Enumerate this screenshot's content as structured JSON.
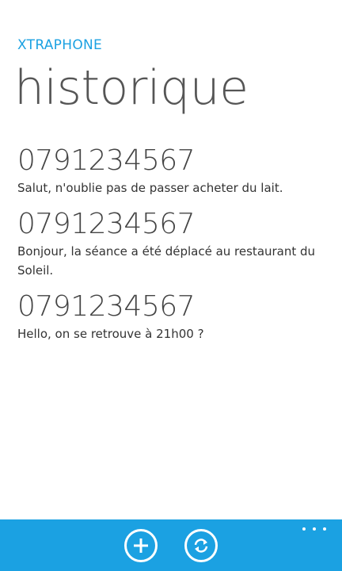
{
  "app": {
    "title": "XTRAPHONE",
    "page_title": "historique"
  },
  "messages": [
    {
      "number": "0791234567",
      "text": "Salut, n'oublie pas de passer acheter du lait."
    },
    {
      "number": "0791234567",
      "text": "Bonjour, la séance a été déplacé au restaurant du Soleil."
    },
    {
      "number": "0791234567",
      "text": "Hello, on se retrouve à 21h00 ?"
    }
  ],
  "app_bar": {
    "buttons": [
      {
        "icon": "add-icon"
      },
      {
        "icon": "sync-icon"
      }
    ],
    "more_icon": "ellipsis-icon",
    "background_color": "#1ba1e2"
  },
  "colors": {
    "accent": "#1ba1e2",
    "title_text": "#555555",
    "body_text": "#333333"
  }
}
